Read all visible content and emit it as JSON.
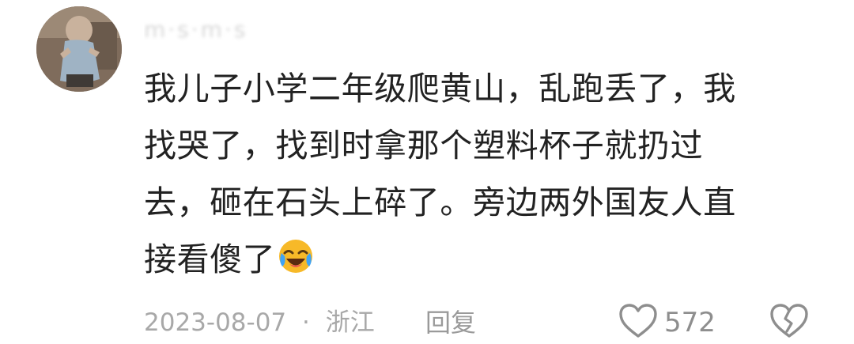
{
  "comment": {
    "username": "m·s·m·s",
    "lines": [
      "我儿子小学二年级爬黄山，乱跑丢了，我",
      "找哭了，找到时拿那个塑料杯子就扔过",
      "去，砸在石头上碎了。旁边两外国友人直",
      "接看傻了"
    ],
    "emoji": "laughing-crying-emoji",
    "date": "2023-08-07",
    "separator": "·",
    "location": "浙江",
    "reply_label": "回复",
    "like_count": "572"
  },
  "icons": {
    "like": "heart-outline-icon",
    "dislike": "broken-heart-icon"
  },
  "colors": {
    "text": "#222222",
    "meta": "#a8a8a8",
    "icon": "#8e8e8e",
    "emoji_face": "#f7b928"
  }
}
